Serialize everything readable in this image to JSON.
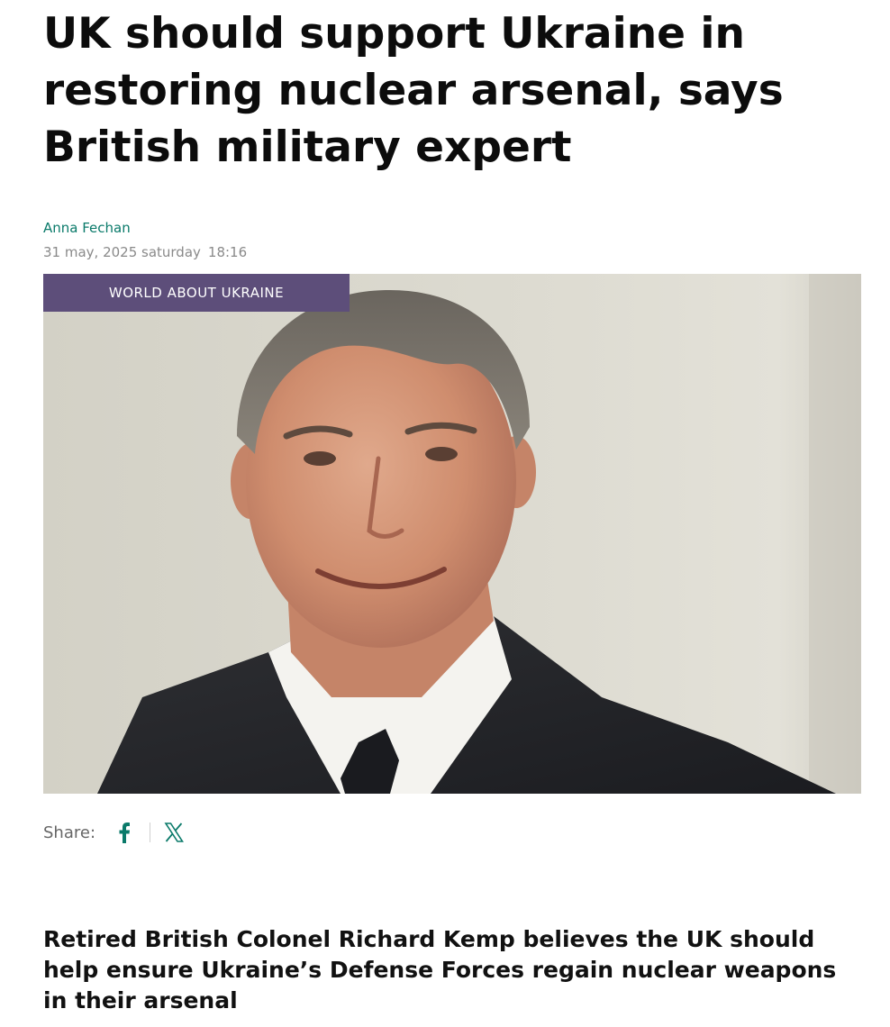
{
  "article": {
    "headline": "UK should support Ukraine in restoring nuclear arsenal, says British military expert",
    "author": "Anna Fechan",
    "date": "31 may, 2025 saturday",
    "time": "18:16",
    "category": "WORLD ABOUT UKRAINE",
    "image_alt": "Retired British Colonel Richard Kemp",
    "lead": "Retired British Colonel Richard Kemp believes the UK should help ensure Ukraine’s Defense Forces regain nuclear weapons in their arsenal"
  },
  "share": {
    "label": "Share:",
    "buttons": [
      {
        "icon": "facebook-icon"
      },
      {
        "icon": "x-icon"
      }
    ]
  },
  "colors": {
    "accent": "#0a7a6a",
    "category_bg": "#5d4e7a",
    "meta_gray": "#8a8a8a"
  }
}
